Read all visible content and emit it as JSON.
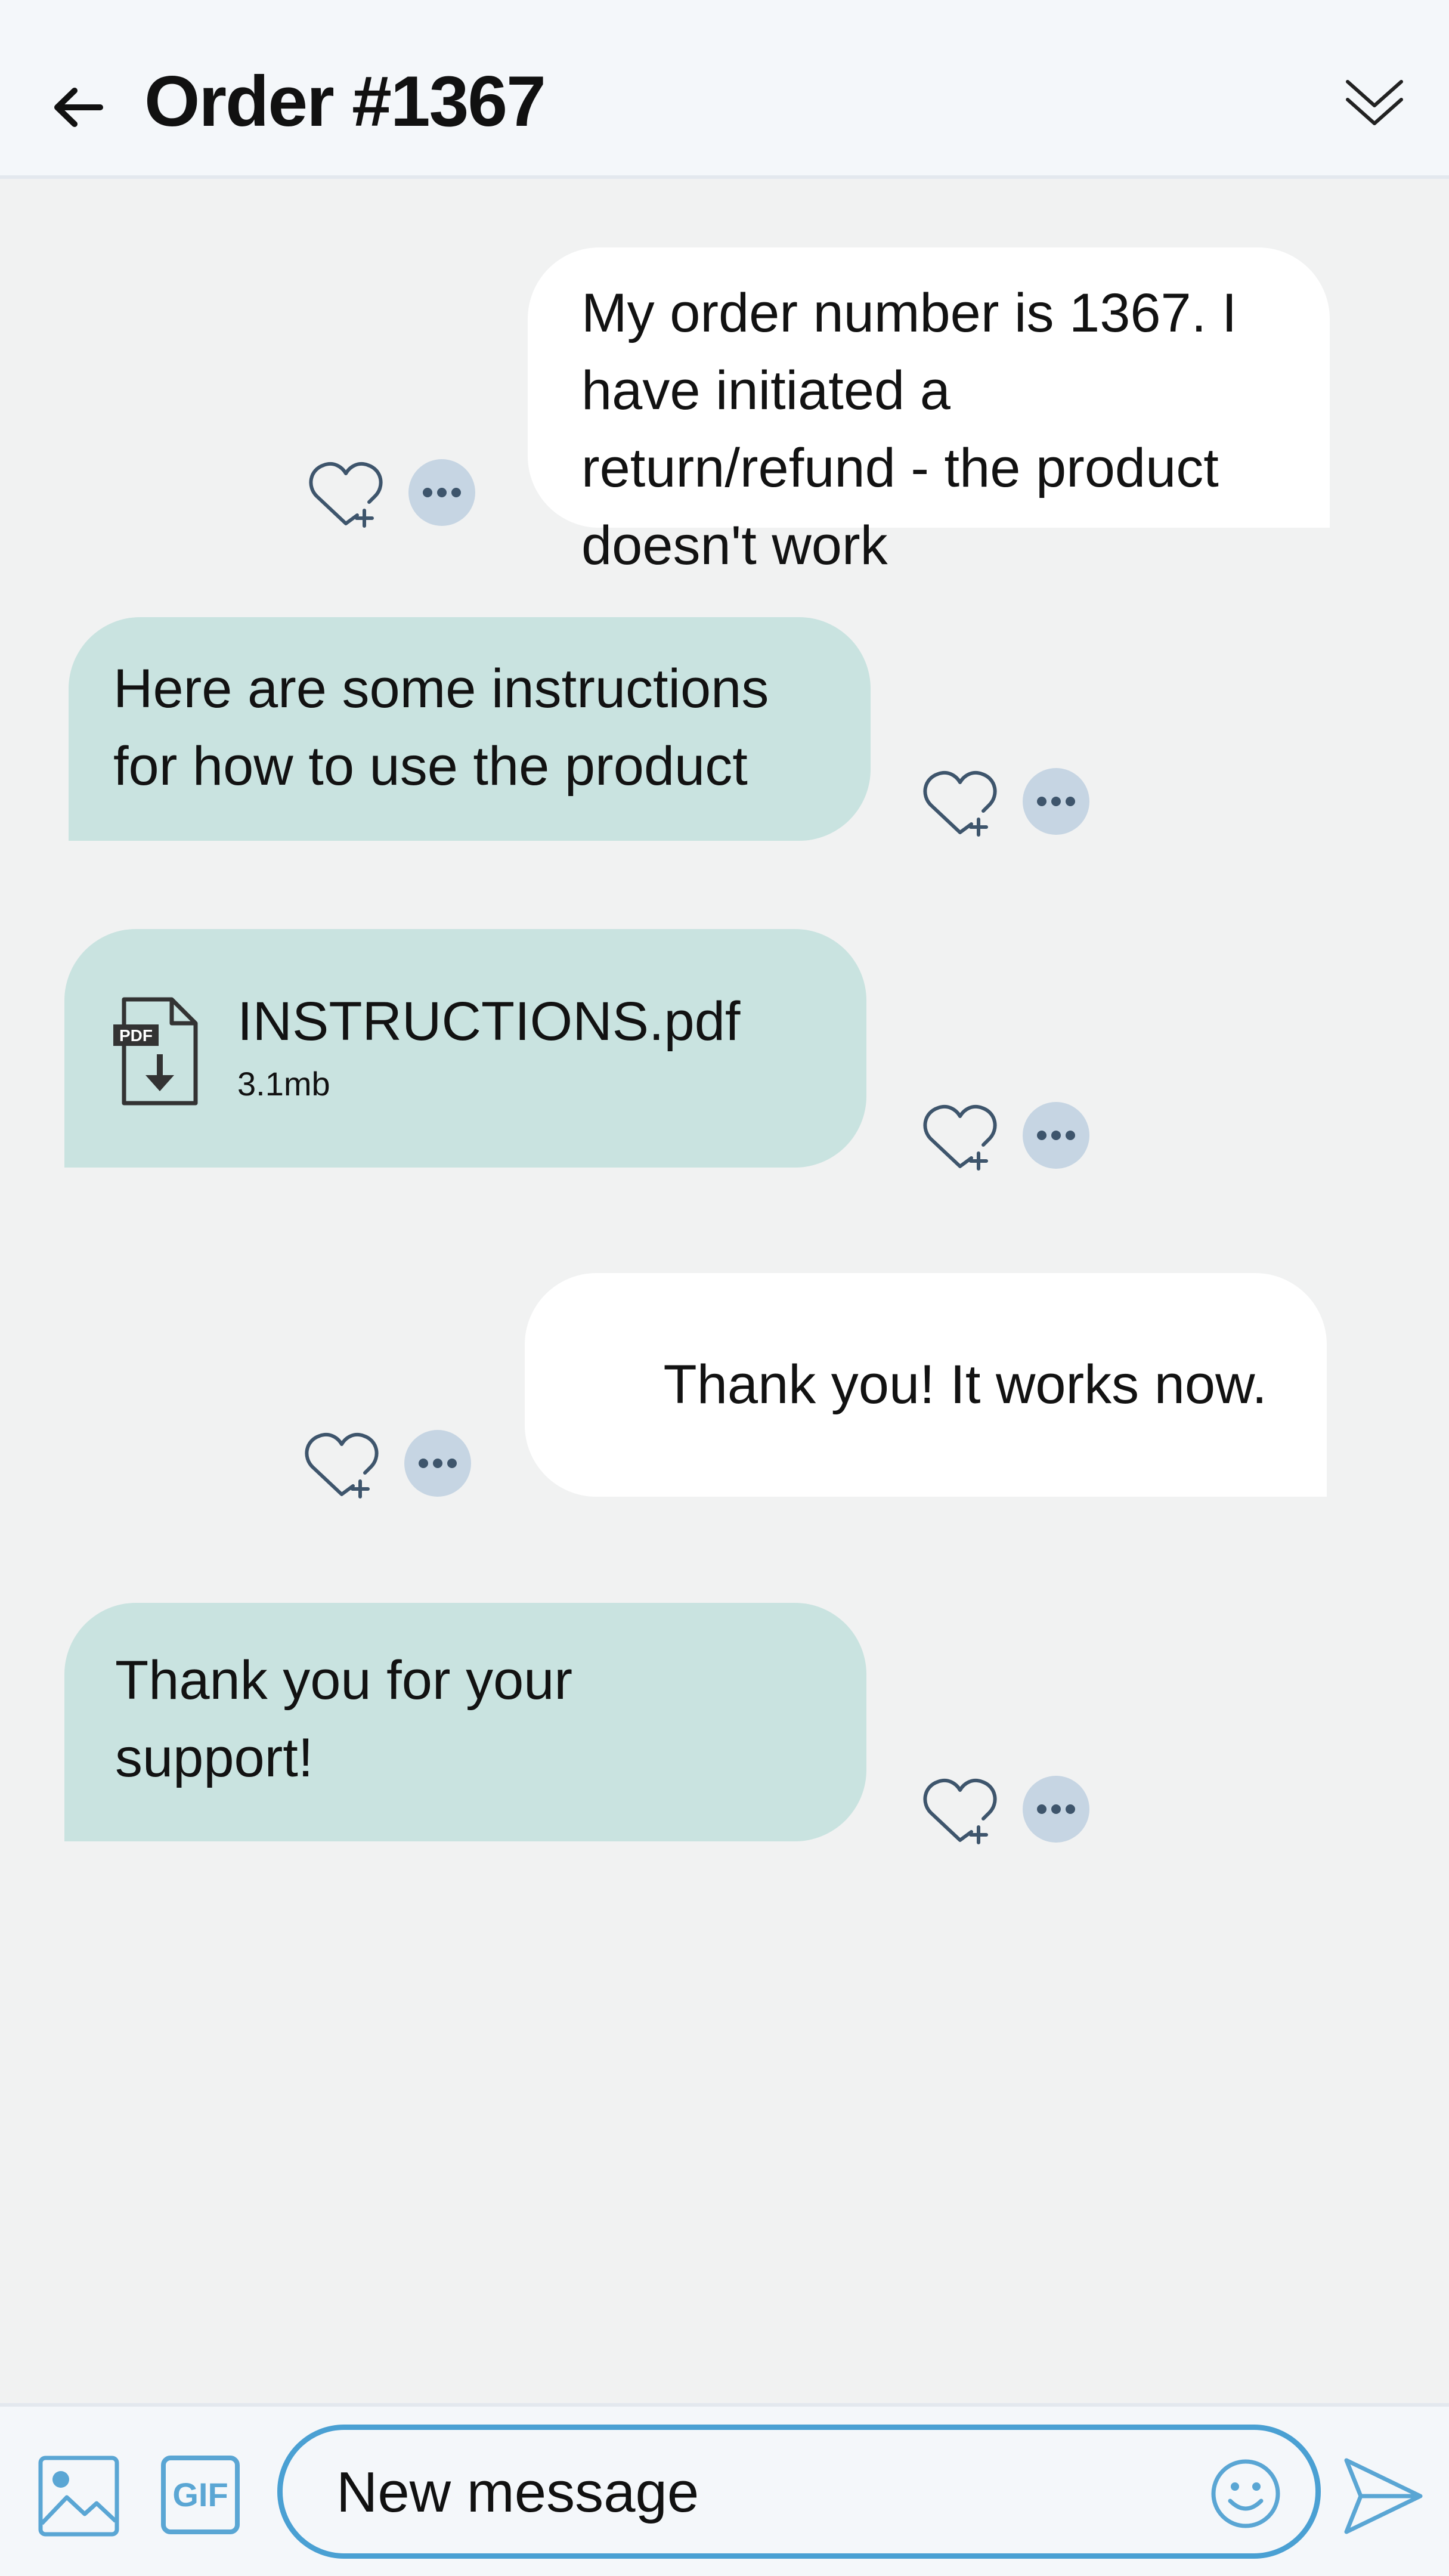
{
  "header": {
    "title": "Order #1367"
  },
  "messages": [
    {
      "direction": "outgoing",
      "text": "My order number is 1367. I have initiated a return/refund - the product doesn't work"
    },
    {
      "direction": "incoming",
      "text": "Here are some instructions for how to use the product"
    },
    {
      "direction": "incoming",
      "type": "file",
      "file_name": "INSTRUCTIONS.pdf",
      "file_size": "3.1mb",
      "icon": "pdf-download-icon"
    },
    {
      "direction": "outgoing",
      "text": "Thank you! It works now."
    },
    {
      "direction": "incoming",
      "text": "Thank you for your support!"
    }
  ],
  "composer": {
    "gif_label": "GIF",
    "placeholder": "New message"
  },
  "icons": {
    "back": "back-arrow-icon",
    "collapse": "chevron-double-down-icon",
    "react": "heart-plus-icon",
    "more": "more-dots-icon",
    "image": "image-icon",
    "emoji": "smiley-icon",
    "send": "send-icon"
  },
  "colors": {
    "outgoing_bubble": "#ffffff",
    "incoming_bubble": "#c9e3e0",
    "accent": "#4aa0d3",
    "background": "#f1f2f2"
  }
}
